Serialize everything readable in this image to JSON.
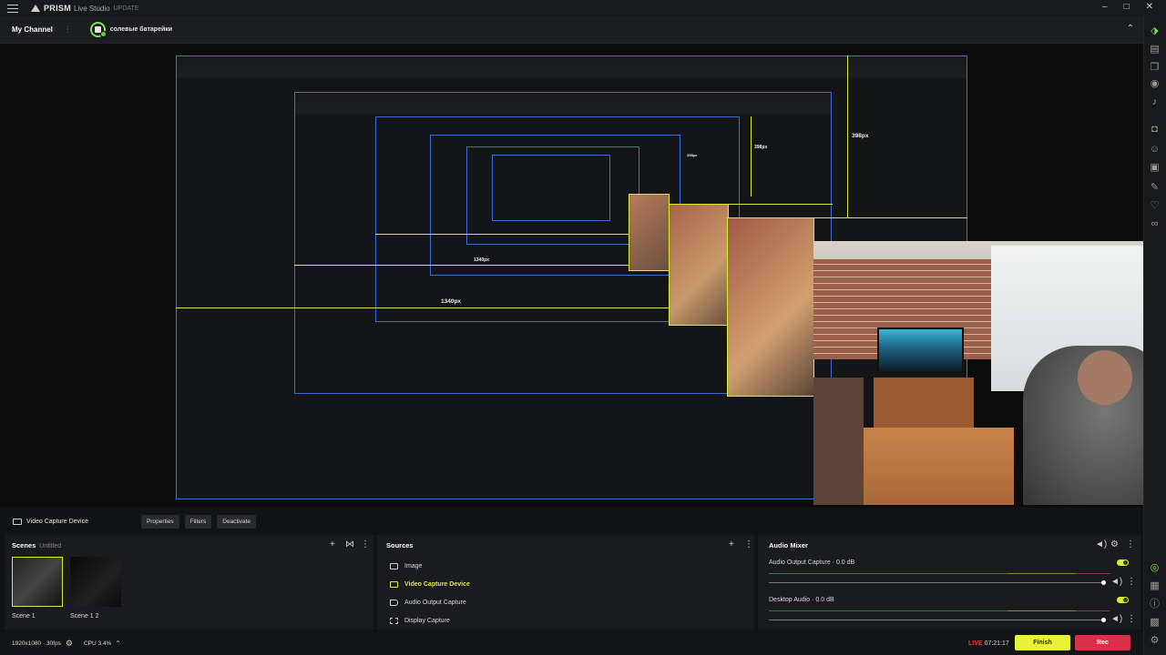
{
  "app": {
    "name": "PRISM",
    "subname": "Live Studio",
    "update": "UPDATE"
  },
  "window_controls": {
    "minimize": "–",
    "restore": "□",
    "close": "✕"
  },
  "channel": {
    "name": "My Channel",
    "label": "солевые батарейки"
  },
  "preview": {
    "annotations": [
      "398px",
      "398px",
      "398px",
      "1340px",
      "1340px"
    ]
  },
  "source_toolbar": {
    "source_name": "Video Capture Device",
    "properties": "Properties",
    "filters": "Filters",
    "deactivate": "Deactivate"
  },
  "scenes": {
    "title": "Scenes",
    "collection": "Untitled",
    "items": [
      {
        "label": "Scene 1"
      },
      {
        "label": "Scene 1 2"
      }
    ]
  },
  "sources": {
    "title": "Sources",
    "items": [
      {
        "label": "Image",
        "icon": "image-icon"
      },
      {
        "label": "Video Capture Device",
        "icon": "camera-icon"
      },
      {
        "label": "Audio Output Capture",
        "icon": "speaker-icon"
      },
      {
        "label": "Display Capture",
        "icon": "display-icon"
      }
    ]
  },
  "mixer": {
    "title": "Audio Mixer",
    "channels": [
      {
        "name": "Audio Output Capture",
        "level": "0.0 dB"
      },
      {
        "name": "Desktop Audio",
        "level": "0.0 dB"
      }
    ]
  },
  "status": {
    "resolution": "1920x1080 · 30fps",
    "cpu": "CPU 3.4%",
    "live_label": "LIVE",
    "live_time": "07:21:17",
    "finish": "Finish",
    "rec": "Rec"
  },
  "colors": {
    "accent": "#d8ec33",
    "rec": "#d8304a",
    "frame_blue": "#3a6fd8",
    "live": "#e23a3a"
  }
}
